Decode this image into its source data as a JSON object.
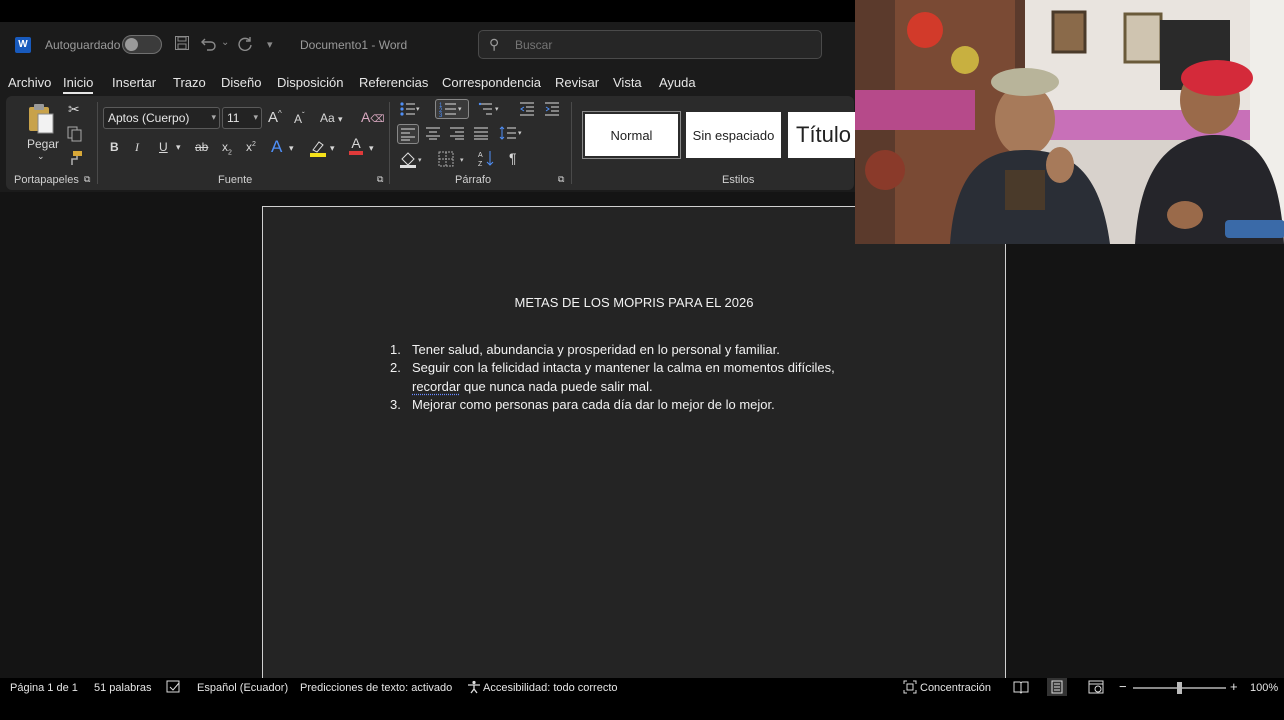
{
  "window": {
    "autosave_label": "Autoguardado",
    "doc_title": "Documento1",
    "app_name": "Word",
    "title_separator": "-"
  },
  "search": {
    "placeholder": "Buscar"
  },
  "menu": [
    {
      "label": "Archivo"
    },
    {
      "label": "Inicio",
      "active": true
    },
    {
      "label": "Insertar"
    },
    {
      "label": "Trazo"
    },
    {
      "label": "Diseño"
    },
    {
      "label": "Disposición"
    },
    {
      "label": "Referencias"
    },
    {
      "label": "Correspondencia"
    },
    {
      "label": "Revisar"
    },
    {
      "label": "Vista"
    },
    {
      "label": "Ayuda"
    }
  ],
  "ribbon": {
    "clipboard": {
      "paste_label": "Pegar",
      "group_label": "Portapapeles"
    },
    "font": {
      "font_name": "Aptos (Cuerpo)",
      "font_size": "11",
      "change_case": "Aa",
      "group_label": "Fuente"
    },
    "paragraph": {
      "group_label": "Párrafo"
    },
    "styles": {
      "items": [
        "Normal",
        "Sin espaciado",
        "Título"
      ],
      "group_label": "Estilos"
    }
  },
  "document": {
    "heading": "METAS DE LOS MOPRIS PARA EL 2026",
    "items": [
      {
        "num": "1.",
        "line1": "Tener salud, abundancia y prosperidad en lo personal y familiar."
      },
      {
        "num": "2.",
        "line1": "Seguir con la felicidad intacta y mantener la calma en momentos difíciles,",
        "line2_word": "recordar",
        "line2_rest": " que nunca nada puede salir mal."
      },
      {
        "num": "3.",
        "line1": "Mejorar como personas para cada día dar lo mejor de lo mejor."
      }
    ]
  },
  "status": {
    "page": "Página 1 de 1",
    "words": "51 palabras",
    "language": "Español (Ecuador)",
    "predictions": "Predicciones de texto: activado",
    "accessibility": "Accesibilidad: todo correcto",
    "focus": "Concentración",
    "zoom": "100%",
    "zoom_level_percent": 100
  },
  "colors": {
    "word_blue": "#185abd",
    "font_color_red": "#e03a3a",
    "highlight_yellow": "#f5e11a",
    "accent_blue": "#4f8ff7"
  },
  "icons": [
    "word-logo-icon",
    "save-icon",
    "undo-icon",
    "redo-icon",
    "customize-icon",
    "search-icon",
    "paste-icon",
    "cut-icon",
    "copy-icon",
    "format-painter-icon",
    "bold-icon",
    "italic-icon",
    "underline-icon",
    "strikethrough-icon",
    "subscript-icon",
    "superscript-icon",
    "text-effects-icon",
    "highlight-icon",
    "font-color-icon",
    "bullets-icon",
    "numbering-icon",
    "multilevel-icon",
    "decrease-indent-icon",
    "increase-indent-icon",
    "align-left-icon",
    "align-center-icon",
    "align-right-icon",
    "justify-icon",
    "line-spacing-icon",
    "shading-icon",
    "borders-icon",
    "sort-icon",
    "pilcrow-icon",
    "proofing-icon",
    "accessibility-icon",
    "focus-icon",
    "read-mode-icon",
    "print-layout-icon",
    "web-layout-icon"
  ]
}
